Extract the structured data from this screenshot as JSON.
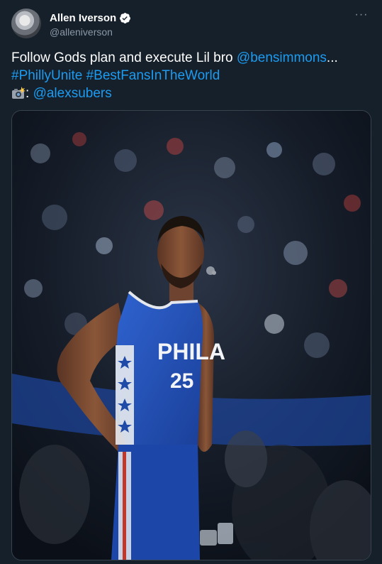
{
  "author": {
    "display_name": "Allen Iverson",
    "handle": "@alleniverson",
    "verified": true,
    "avatar_icon": "avatar-photo"
  },
  "menu_icon": "more-horizontal-icon",
  "tweet_text": {
    "line1_text": "Follow Gods plan and execute Lil bro ",
    "line1_mention": "@bensimmons",
    "line1_ellipsis": "...",
    "hashtag1": "#PhillyUnite",
    "hashtag2": "#BestFansInTheWorld",
    "camera_icon": "camera-flash-emoji",
    "credit_separator": ": ",
    "credit_mention": "@alexsubers"
  },
  "media": {
    "jersey_team": "PHILA",
    "jersey_number": "25"
  },
  "colors": {
    "background": "#15202b",
    "link": "#1d9bf0",
    "secondary_text": "#8b98a5",
    "verified": "#ffffff",
    "jersey_blue": "#1f4fb5"
  }
}
